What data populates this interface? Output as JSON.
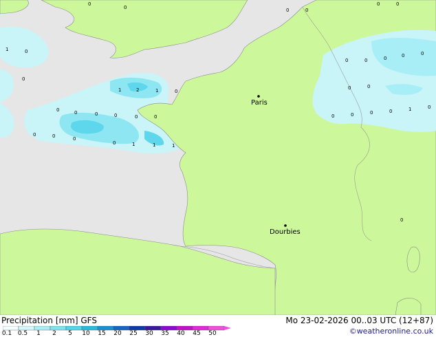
{
  "map": {
    "cities": [
      {
        "name": "Paris",
        "dot": "city-dot"
      },
      {
        "name": "Dourbies",
        "dot": "city-dot"
      }
    ],
    "precip_labels": [
      "1",
      "2",
      "1",
      "0",
      "0",
      "0",
      "0",
      "0",
      "0",
      "0",
      "0",
      "1",
      "1",
      "1",
      "0",
      "0",
      "0",
      "0",
      "0",
      "0",
      "0",
      "1",
      "0",
      "0",
      "0",
      "0",
      "0",
      "0",
      "0",
      "0",
      "0",
      "0",
      "0",
      "0",
      "1",
      "0",
      "0",
      "0",
      "0",
      "0"
    ]
  },
  "legend": {
    "title": "Precipitation [mm]  GFS",
    "date": "Mo 23-02-2026 00..03 UTC (12+87)",
    "credit": "©weatheronline.co.uk",
    "ticks": [
      "0.1",
      "0.5",
      "1",
      "2",
      "5",
      "10",
      "15",
      "20",
      "25",
      "30",
      "35",
      "40",
      "45",
      "50"
    ],
    "colors": [
      "#f5fdff",
      "#d3f8fb",
      "#a8eef6",
      "#7fe2f0",
      "#52d4ea",
      "#2ab8e0",
      "#1c8fd1",
      "#1566c0",
      "#0d3ba6",
      "#3a1a9c",
      "#8a0ad0",
      "#c010c8",
      "#e02ad6",
      "#f050e0"
    ]
  }
}
